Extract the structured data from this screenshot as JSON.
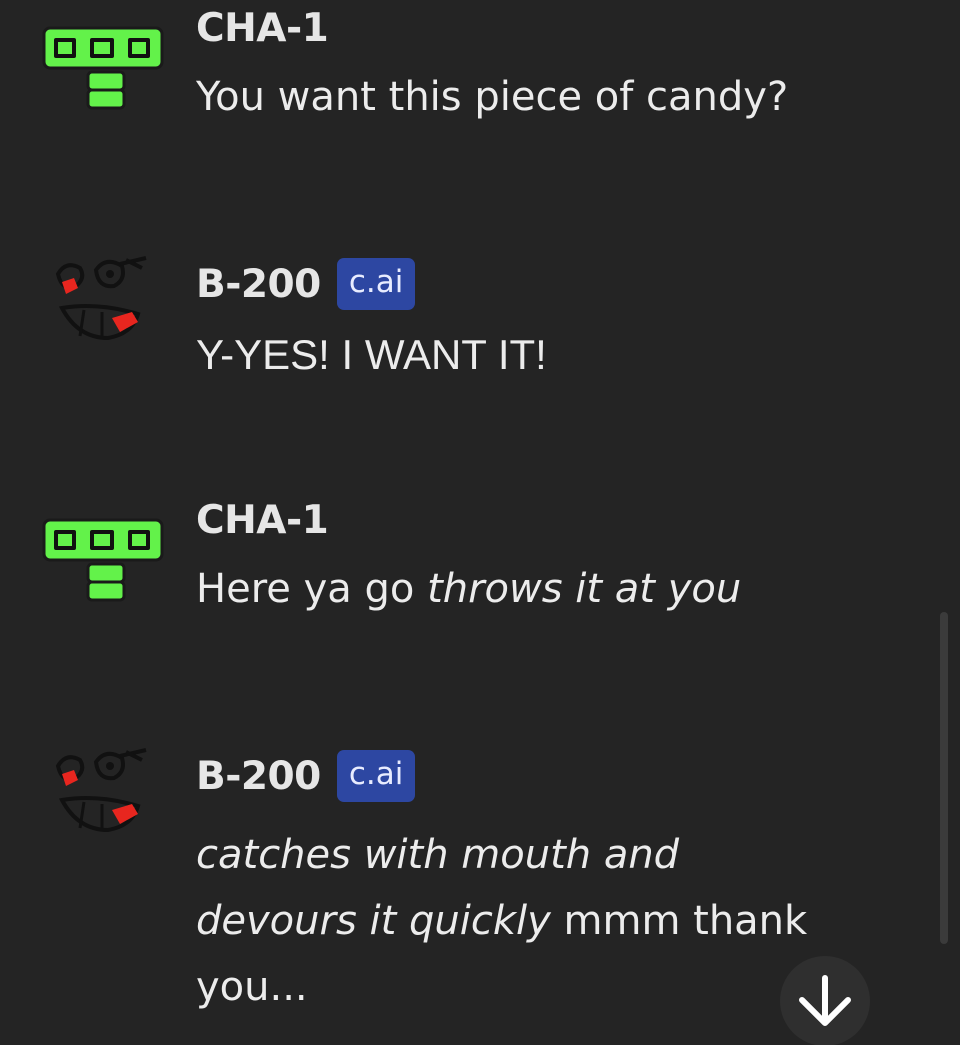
{
  "messages": [
    {
      "author": "CHA-1",
      "badge": "",
      "parts": [
        {
          "text": "You want this piece of candy?",
          "italic": false
        }
      ]
    },
    {
      "author": "B-200",
      "badge": "c.ai",
      "parts": [
        {
          "text": "Y-YES! I WANT IT!",
          "italic": false
        }
      ]
    },
    {
      "author": "CHA-1",
      "badge": "",
      "parts": [
        {
          "text": "Here ya go ",
          "italic": false
        },
        {
          "text": "throws it at you",
          "italic": true
        }
      ]
    },
    {
      "author": "B-200",
      "badge": "c.ai",
      "parts": [
        {
          "text": "catches with mouth and devours it quickly",
          "italic": true
        },
        {
          "text": " mmm thank you...",
          "italic": false
        }
      ]
    }
  ],
  "icons": {
    "cha1_avatar": "green-robot-face-icon",
    "b200_avatar": "doodle-face-icon",
    "scroll_down": "arrow-down-icon"
  },
  "colors": {
    "background": "#242424",
    "badge": "#2d47a2",
    "avatar_green": "#63f24a",
    "avatar_red": "#e8261f"
  }
}
